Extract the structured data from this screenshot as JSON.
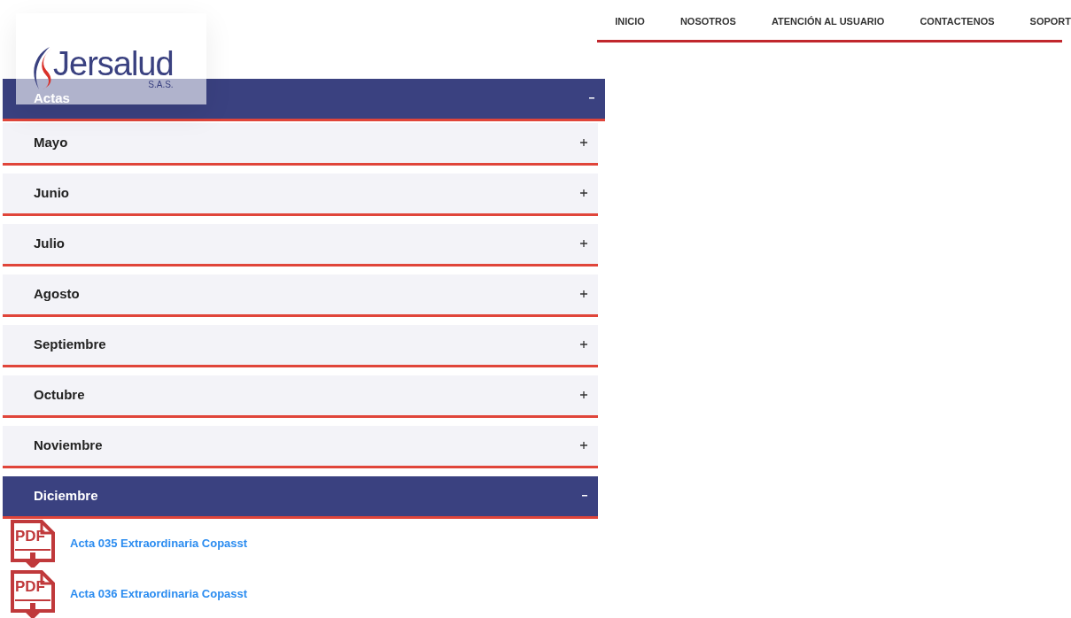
{
  "logo": {
    "name": "Jersalud",
    "suffix": "S.A.S."
  },
  "nav": [
    {
      "label": "INICIO"
    },
    {
      "label": "NOSOTROS"
    },
    {
      "label": "ATENCIÓN AL USUARIO"
    },
    {
      "label": "CONTACTENOS"
    },
    {
      "label": "SOPORT"
    }
  ],
  "accordion": {
    "title": "Actas",
    "expanded": true,
    "sections": [
      {
        "label": "Mayo",
        "expanded": false
      },
      {
        "label": "Junio",
        "expanded": false
      },
      {
        "label": "Julio",
        "expanded": false
      },
      {
        "label": "Agosto",
        "expanded": false
      },
      {
        "label": "Septiembre",
        "expanded": false
      },
      {
        "label": "Octubre",
        "expanded": false
      },
      {
        "label": "Noviembre",
        "expanded": false
      },
      {
        "label": "Diciembre",
        "expanded": true,
        "documents": [
          {
            "icon_label": "PDF",
            "title": "Acta 035 Extraordinaria Copasst"
          },
          {
            "icon_label": "PDF",
            "title": "Acta 036 Extraordinaria Copasst"
          }
        ]
      }
    ]
  }
}
